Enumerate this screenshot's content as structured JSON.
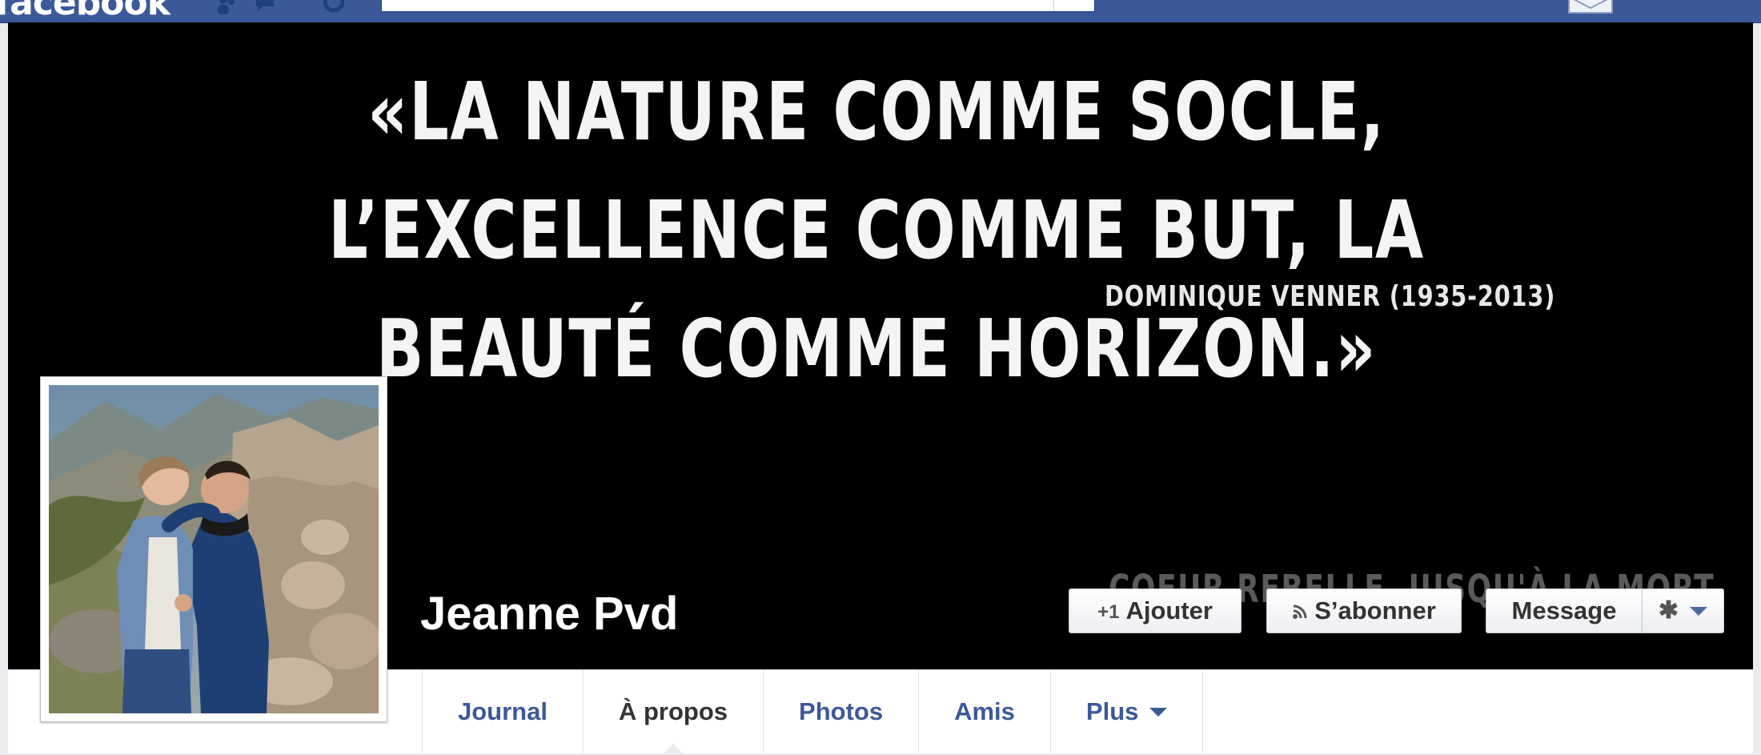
{
  "topbar": {
    "logo_text": "facebook",
    "icons": [
      "friend-requests-icon",
      "messages-icon",
      "notifications-icon",
      "mail-icon"
    ],
    "colors": {
      "bar": "#3b5998",
      "border": "#29487d"
    }
  },
  "cover": {
    "quote": "«La nature comme socle, l’excellence comme but, la beauté comme horizon.»",
    "attribution": "DOMINIQUE VENNER (1935-2013)",
    "motto": "COEUR REBELLE, JUSQU'À LA MORT"
  },
  "profile": {
    "name": "Jeanne Pvd",
    "photo": "couple-mountain-photo"
  },
  "actions": {
    "add_label": "Ajouter",
    "subscribe_label": "S’abonner",
    "message_label": "Message",
    "add_icon": "add-friend-icon",
    "subscribe_icon": "rss-icon",
    "settings_icon": "gear-icon"
  },
  "tabs": [
    {
      "label": "Journal",
      "active": false
    },
    {
      "label": "À propos",
      "active": true
    },
    {
      "label": "Photos",
      "active": false
    },
    {
      "label": "Amis",
      "active": false
    },
    {
      "label": "Plus",
      "active": false
    }
  ]
}
